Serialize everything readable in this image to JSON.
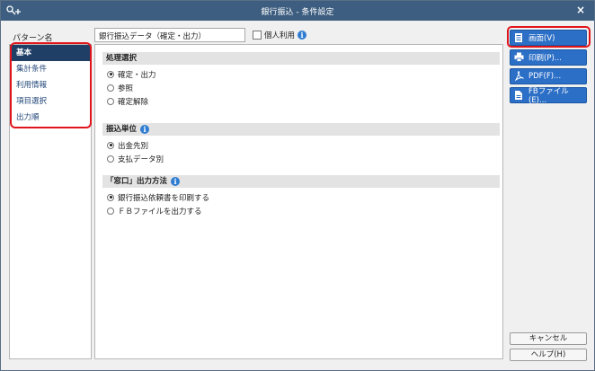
{
  "window": {
    "title": "銀行振込 - 条件設定",
    "close_label": "×",
    "icon": "key-plus-icon"
  },
  "pattern": {
    "label": "パターン名",
    "value": "銀行振込データ（確定・出力）",
    "personal_label": "個人利用",
    "personal_checked": false
  },
  "sidebar": {
    "items": [
      {
        "label": "基本",
        "active": true
      },
      {
        "label": "集計条件"
      },
      {
        "label": "利用情報"
      },
      {
        "label": "項目選択"
      },
      {
        "label": "出力順"
      }
    ]
  },
  "sections": [
    {
      "title": "処理選択",
      "has_info": false,
      "options": [
        {
          "label": "確定・出力",
          "selected": true
        },
        {
          "label": "参照",
          "selected": false
        },
        {
          "label": "確定解除",
          "selected": false
        }
      ]
    },
    {
      "title": "振込単位",
      "has_info": true,
      "options": [
        {
          "label": "出金先別",
          "selected": true
        },
        {
          "label": "支払データ別",
          "selected": false
        }
      ]
    },
    {
      "title": "「窓口」出力方法",
      "has_info": true,
      "options": [
        {
          "label": "銀行振込依頼書を印刷する",
          "selected": true
        },
        {
          "label": "ＦＢファイルを出力する",
          "selected": false
        }
      ]
    }
  ],
  "actions": {
    "screen": "画面(V)",
    "print": "印刷(P)...",
    "pdf": "PDF(F)...",
    "fb_file": "FBファイル(E)..."
  },
  "footer": {
    "cancel": "キャンセル",
    "help": "ヘルプ(H)"
  },
  "colors": {
    "titlebar": "#3d5e80",
    "accent_button": "#2c6fc6",
    "sidebar_active": "#1f3f66",
    "highlight": "#e0151c"
  }
}
